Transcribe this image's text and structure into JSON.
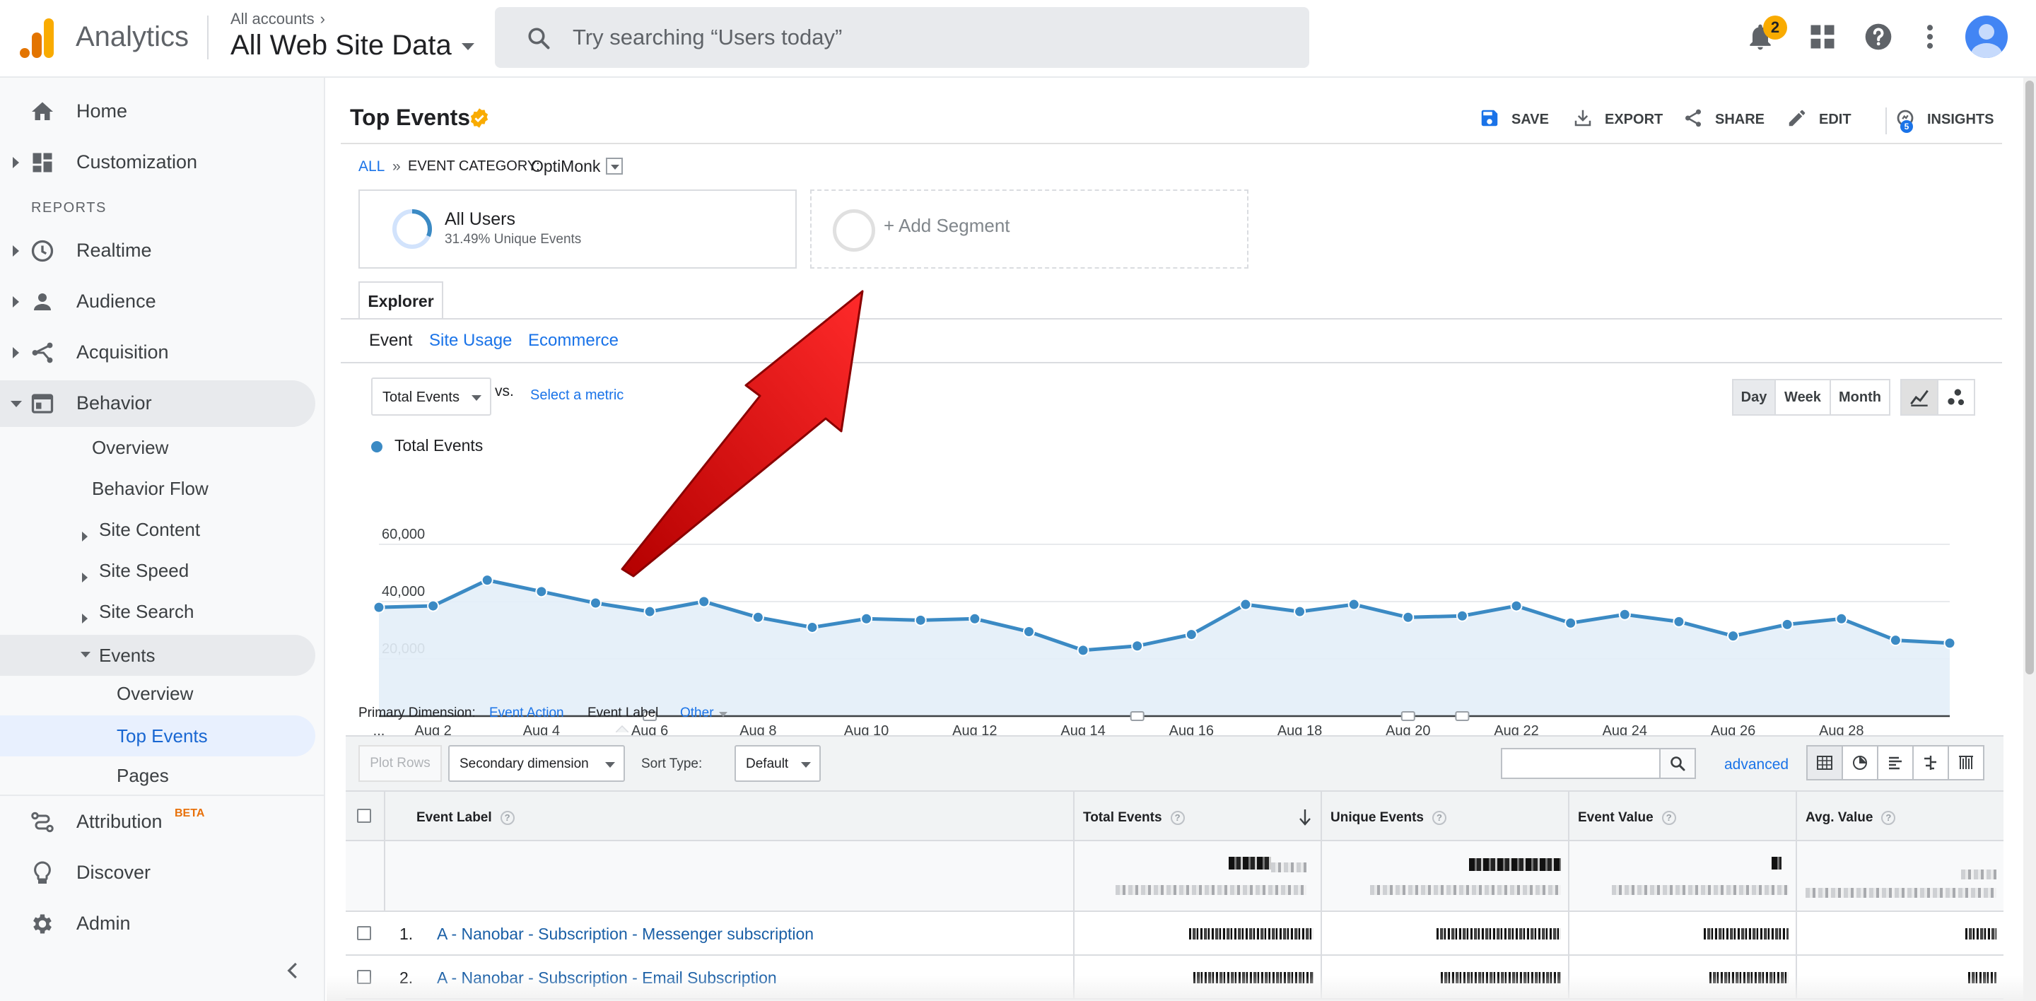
{
  "header": {
    "product_name": "Analytics",
    "account_crumb": "All accounts",
    "property_name": "All Web Site Data",
    "search_placeholder": "Try searching “Users today”",
    "notification_count": "2"
  },
  "sidebar": {
    "top_items": [
      {
        "label": "Home",
        "icon": "home-icon"
      },
      {
        "label": "Customization",
        "icon": "dashboard-icon"
      }
    ],
    "reports_heading": "REPORTS",
    "report_items": [
      {
        "label": "Realtime",
        "icon": "clock-icon"
      },
      {
        "label": "Audience",
        "icon": "person-icon"
      },
      {
        "label": "Acquisition",
        "icon": "acquisition-icon"
      },
      {
        "label": "Behavior",
        "icon": "behavior-icon"
      }
    ],
    "behavior_sub": [
      "Overview",
      "Behavior Flow",
      "Site Content",
      "Site Speed",
      "Site Search",
      "Events"
    ],
    "events_sub": [
      "Overview",
      "Top Events",
      "Pages"
    ],
    "bottom_items": [
      {
        "label": "Attribution",
        "badge": "BETA",
        "icon": "attribution-icon"
      },
      {
        "label": "Discover",
        "icon": "lightbulb-icon"
      },
      {
        "label": "Admin",
        "icon": "gear-icon"
      }
    ]
  },
  "report": {
    "title": "Top Events",
    "toolbar": {
      "save": "SAVE",
      "export": "EXPORT",
      "share": "SHARE",
      "edit": "EDIT",
      "insights": "INSIGHTS",
      "insights_badge": "5"
    },
    "breadcrumb": {
      "all": "ALL",
      "separator": "»",
      "category_label": "EVENT CATEGORY:",
      "category_value": "OptiMonk"
    },
    "segments": {
      "all_users": "All Users",
      "all_users_sub": "31.49% Unique Events",
      "all_users_fraction": 0.3149,
      "add_segment": "+ Add Segment"
    },
    "tab": "Explorer",
    "subtabs": [
      "Event",
      "Site Usage",
      "Ecommerce"
    ],
    "metric_select": "Total Events",
    "vs": "vs.",
    "select_metric": "Select a metric",
    "granularity": [
      "Day",
      "Week",
      "Month"
    ],
    "active_granularity": "Day"
  },
  "chart_data": {
    "type": "area",
    "series": [
      {
        "name": "Total Events",
        "color": "#3b8ac4",
        "values": [
          38000,
          38500,
          47500,
          43500,
          39500,
          36500,
          40000,
          34500,
          31000,
          34000,
          33500,
          34000,
          29500,
          23000,
          24500,
          28500,
          39000,
          36500,
          39000,
          34500,
          35000,
          38500,
          32500,
          35500,
          33000,
          28000,
          32000,
          34000,
          26500,
          25500
        ]
      }
    ],
    "x_ticks": [
      "...",
      "Aug 2",
      "Aug 4",
      "Aug 6",
      "Aug 8",
      "Aug 10",
      "Aug 12",
      "Aug 14",
      "Aug 16",
      "Aug 18",
      "Aug 20",
      "Aug 22",
      "Aug 24",
      "Aug 26",
      "Aug 28"
    ],
    "y_ticks": [
      "60,000",
      "40,000",
      "20,000"
    ],
    "ylim": [
      0,
      60000
    ],
    "grid": true
  },
  "dimensions": {
    "label": "Primary Dimension:",
    "event_action": "Event Action",
    "event_label": "Event Label",
    "other": "Other"
  },
  "table_toolbar": {
    "plot_rows": "Plot Rows",
    "secondary_dimension": "Secondary dimension",
    "sort_type_label": "Sort Type:",
    "sort_type_value": "Default",
    "advanced": "advanced"
  },
  "table": {
    "columns": [
      "Event Label",
      "Total Events",
      "Unique Events",
      "Event Value",
      "Avg. Value"
    ],
    "rows": [
      {
        "num": "1.",
        "label": "A - Nanobar - Subscription - Messenger subscription"
      },
      {
        "num": "2.",
        "label": "A - Nanobar - Subscription - Email Subscription"
      }
    ]
  }
}
